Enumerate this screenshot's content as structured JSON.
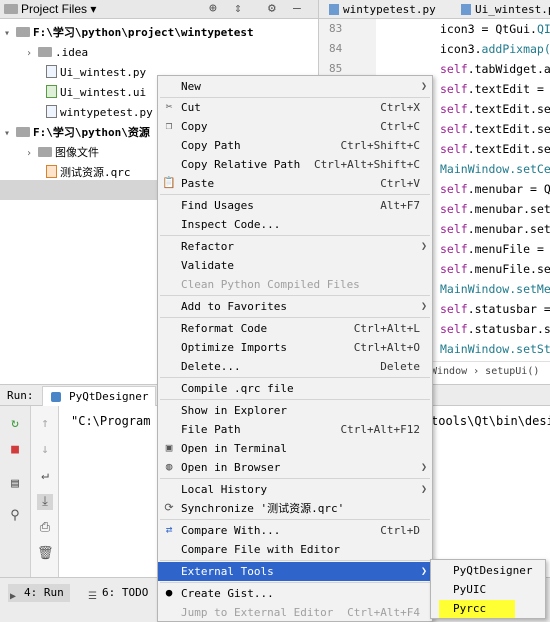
{
  "project_panel": {
    "title": "Project Files",
    "header_icons": [
      "target-icon",
      "collapse-icon",
      "gear-icon",
      "minimize-icon"
    ],
    "tree": [
      {
        "label": "F:\\学习\\python\\project\\wintypetest",
        "type": "folder",
        "bold": true,
        "expanded": true
      },
      {
        "label": ".idea",
        "type": "folder",
        "bold": false,
        "expanded": false
      },
      {
        "label": "Ui_wintest.py",
        "type": "py"
      },
      {
        "label": "Ui_wintest.ui",
        "type": "ui"
      },
      {
        "label": "wintypetest.py",
        "type": "py"
      },
      {
        "label": "F:\\学习\\python\\资源",
        "type": "folder",
        "bold": true,
        "expanded": true
      },
      {
        "label": "图像文件",
        "type": "folder",
        "bold": false,
        "expanded": false
      },
      {
        "label": "测试资源.qrc",
        "type": "qrc",
        "selected": true
      }
    ]
  },
  "editor": {
    "tabs": [
      {
        "label": "wintypetest.py"
      },
      {
        "label": "Ui_wintest.py"
      }
    ],
    "line_numbers": [
      "83",
      "84",
      "85"
    ],
    "code_lines": [
      {
        "a": "icon3 = QtGui.",
        "b": "QI",
        "c": ""
      },
      {
        "a": "icon3.",
        "b": "addPixmap(",
        "c": ""
      },
      {
        "a": "self",
        "b": ".tabWidget.a",
        "c": ""
      },
      {
        "a": "self",
        "b": ".textEdit =",
        "c": ""
      },
      {
        "a": "self",
        "b": ".textEdit.se",
        "c": ""
      },
      {
        "a": "self",
        "b": ".textEdit.se",
        "c": ""
      },
      {
        "a": "self",
        "b": ".textEdit.se",
        "c": ""
      },
      {
        "a": "MainWindow.setCe",
        "b": "",
        "c": ""
      },
      {
        "a": "self",
        "b": ".menubar = Q",
        "c": ""
      },
      {
        "a": "self",
        "b": ".menubar.set",
        "c": ""
      },
      {
        "a": "self",
        "b": ".menubar.set",
        "c": ""
      },
      {
        "a": "self",
        "b": ".menuFile =",
        "c": ""
      },
      {
        "a": "self",
        "b": ".menuFile.se",
        "c": ""
      },
      {
        "a": "MainWindow.setMe",
        "b": "",
        "c": ""
      },
      {
        "a": "self",
        "b": ".statusbar =",
        "c": ""
      },
      {
        "a": "self",
        "b": ".statusbar.s",
        "c": ""
      },
      {
        "a": "MainWindow.setSt",
        "b": "",
        "c": ""
      }
    ],
    "breadcrumb": "Window  ›  setupUi()"
  },
  "run_panel": {
    "label": "Run:",
    "tab_label": "PyQtDesigner",
    "console_line": "\"C:\\Program",
    "console_line_tail": "tools\\Qt\\bin\\desig"
  },
  "status_bar": {
    "run_tab": "4: Run",
    "todo_tab": "6: TODO"
  },
  "context_menu": {
    "items": [
      {
        "label": "New",
        "shortcut": "",
        "submenu": true
      },
      {
        "sep": true
      },
      {
        "label": "Cut",
        "shortcut": "Ctrl+X",
        "icon": "cut-icon"
      },
      {
        "label": "Copy",
        "shortcut": "Ctrl+C",
        "icon": "copy-icon"
      },
      {
        "label": "Copy Path",
        "shortcut": "Ctrl+Shift+C"
      },
      {
        "label": "Copy Relative Path",
        "shortcut": "Ctrl+Alt+Shift+C"
      },
      {
        "label": "Paste",
        "shortcut": "Ctrl+V",
        "icon": "paste-icon"
      },
      {
        "sep": true
      },
      {
        "label": "Find Usages",
        "shortcut": "Alt+F7"
      },
      {
        "label": "Inspect Code...",
        "shortcut": ""
      },
      {
        "sep": true
      },
      {
        "label": "Refactor",
        "shortcut": "",
        "submenu": true
      },
      {
        "label": "Validate",
        "shortcut": ""
      },
      {
        "label": "Clean Python Compiled Files",
        "shortcut": "",
        "disabled": true
      },
      {
        "sep": true
      },
      {
        "label": "Add to Favorites",
        "shortcut": "",
        "submenu": true
      },
      {
        "sep": true
      },
      {
        "label": "Reformat Code",
        "shortcut": "Ctrl+Alt+L"
      },
      {
        "label": "Optimize Imports",
        "shortcut": "Ctrl+Alt+O"
      },
      {
        "label": "Delete...",
        "shortcut": "Delete"
      },
      {
        "sep": true
      },
      {
        "label": "Compile .qrc file",
        "shortcut": ""
      },
      {
        "sep": true
      },
      {
        "label": "Show in Explorer",
        "shortcut": ""
      },
      {
        "label": "File Path",
        "shortcut": "Ctrl+Alt+F12"
      },
      {
        "label": "Open in Terminal",
        "shortcut": "",
        "icon": "terminal-icon"
      },
      {
        "label": "Open in Browser",
        "shortcut": "",
        "submenu": true,
        "icon": "globe-icon"
      },
      {
        "sep": true
      },
      {
        "label": "Local History",
        "shortcut": "",
        "submenu": true
      },
      {
        "label": "Synchronize '测试资源.qrc'",
        "shortcut": "",
        "icon": "sync-icon"
      },
      {
        "sep": true
      },
      {
        "label": "Compare With...",
        "shortcut": "Ctrl+D",
        "icon": "compare-icon"
      },
      {
        "label": "Compare File with Editor",
        "shortcut": ""
      },
      {
        "sep": true
      },
      {
        "label": "External Tools",
        "shortcut": "",
        "submenu": true,
        "highlight": true
      },
      {
        "sep": true
      },
      {
        "label": "Create Gist...",
        "shortcut": "",
        "icon": "github-icon"
      },
      {
        "label": "Jump to External Editor",
        "shortcut": "Ctrl+Alt+F4",
        "disabled": true
      }
    ]
  },
  "submenu": {
    "items": [
      "PyQtDesigner",
      "PyUIC",
      "Pyrcc"
    ],
    "highlighted_color": "#ffff33"
  },
  "colors": {
    "menu_highlight": "#2f65ca",
    "keyword_self": "#9b2393",
    "class_ref": "#1f7a8c"
  }
}
